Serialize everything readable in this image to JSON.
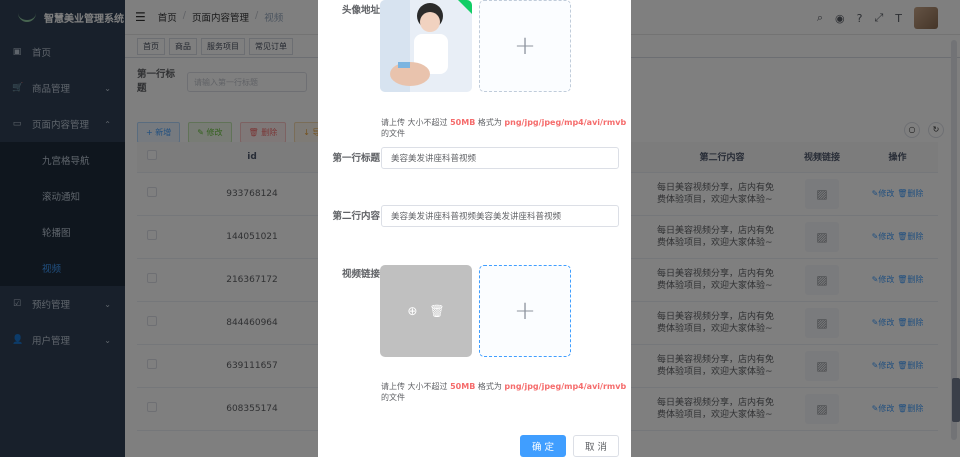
{
  "app": {
    "title": "智慧美业管理系统"
  },
  "sidebar": {
    "items": [
      {
        "label": "首页",
        "icon": "dashboard-icon"
      },
      {
        "label": "商品管理",
        "icon": "cart-icon"
      },
      {
        "label": "页面内容管理",
        "icon": "book-icon"
      },
      {
        "label": "九宫格导航"
      },
      {
        "label": "滚动通知"
      },
      {
        "label": "轮播图"
      },
      {
        "label": "视频"
      },
      {
        "label": "预约管理",
        "icon": "check-icon"
      },
      {
        "label": "用户管理",
        "icon": "user-icon"
      }
    ]
  },
  "header": {
    "breadcrumb": [
      "首页",
      "页面内容管理",
      "视频"
    ]
  },
  "tags": [
    "首页",
    "商品",
    "服务项目",
    "常见订单"
  ],
  "search": {
    "label": "第一行标题",
    "placeholder": "请输入第一行标题"
  },
  "buttons": {
    "add": "+ 新增",
    "edit": "✎ 修改",
    "delete": "🗑 删除",
    "export": "↓ 导出"
  },
  "table": {
    "headers": [
      "id",
      "第二行内容",
      "视频链接",
      "操作"
    ],
    "rows": [
      {
        "id": "933768124",
        "desc1": "每日美容视频分享，店内有免",
        "desc2": "费体验项目，欢迎大家体验~"
      },
      {
        "id": "144051021",
        "desc1": "每日美容视频分享，店内有免",
        "desc2": "费体验项目，欢迎大家体验~"
      },
      {
        "id": "216367172",
        "desc1": "每日美容视频分享，店内有免",
        "desc2": "费体验项目，欢迎大家体验~"
      },
      {
        "id": "844460964",
        "desc1": "每日美容视频分享，店内有免",
        "desc2": "费体验项目，欢迎大家体验~"
      },
      {
        "id": "639111657",
        "desc1": "每日美容视频分享，店内有免",
        "desc2": "费体验项目，欢迎大家体验~"
      },
      {
        "id": "608355174",
        "desc1": "每日美容视频分享，店内有免",
        "desc2": "费体验项目，欢迎大家体验~"
      }
    ],
    "op_edit": "✎修改",
    "op_delete": "🗑删除"
  },
  "dialog": {
    "avatar_label": "头像地址",
    "upload_hint_prefix": "请上传 大小不超过 ",
    "upload_hint_size": "50MB",
    "upload_hint_mid": " 格式为 ",
    "upload_hint_formats": "png/jpg/jpeg/mp4/avi/rmvb",
    "upload_hint_suffix": " 的文件",
    "title1_label": "第一行标题",
    "title1_value": "美容美发讲座科普视频",
    "title2_label": "第二行内容",
    "title2_value": "美容美发讲座科普视频美容美发讲座科普视频",
    "video_label": "视频链接",
    "confirm": "确 定",
    "cancel": "取 消"
  }
}
